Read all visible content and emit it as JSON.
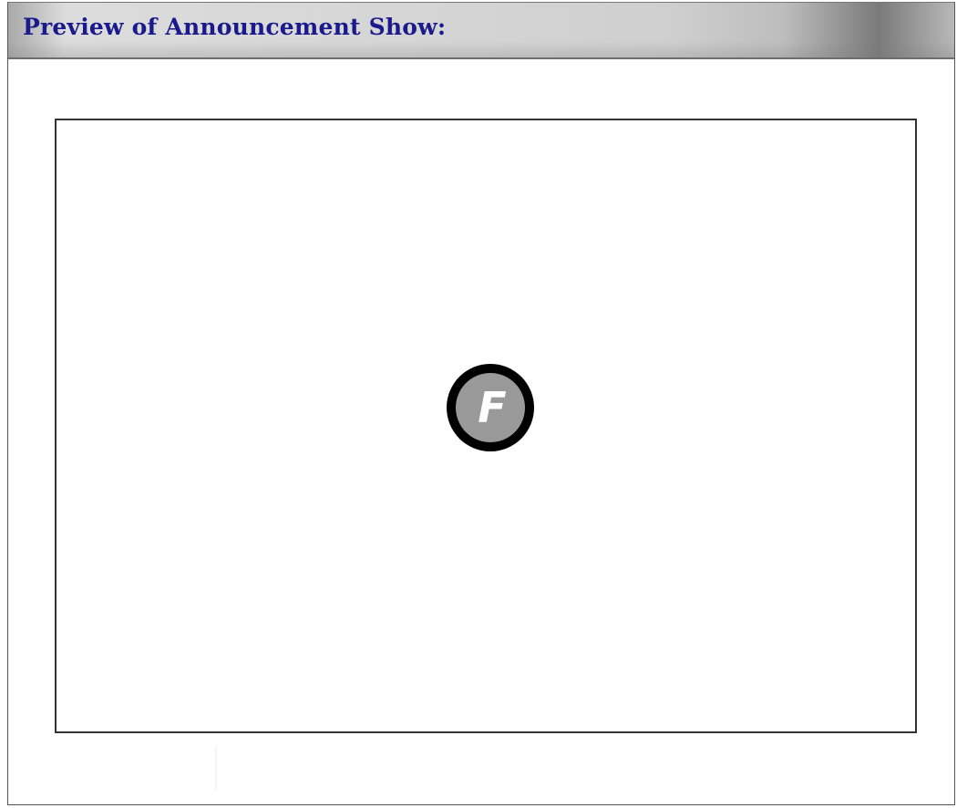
{
  "header": {
    "title": "Preview of Announcement Show:"
  },
  "preview": {
    "placeholder_icon": "flash-player-icon",
    "icon_letter": "F",
    "icon_ring_color": "#000000",
    "icon_fill_color": "#999999",
    "icon_letter_color": "#ffffff"
  },
  "colors": {
    "title_text": "#1a1a8c",
    "frame_border": "#333333",
    "header_gradient": [
      "#a9a9a9",
      "#d6d6d6",
      "#7a7a7a"
    ]
  }
}
